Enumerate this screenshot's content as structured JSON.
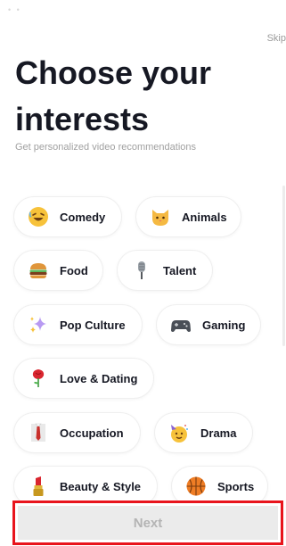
{
  "header": {
    "status_dots": "• •",
    "skip_label": "Skip",
    "title": "Choose your interests",
    "subtitle": "Get personalized video recommendations"
  },
  "interests": [
    {
      "label": "Comedy",
      "icon": "laughing-face-icon"
    },
    {
      "label": "Animals",
      "icon": "cat-face-icon"
    },
    {
      "label": "Food",
      "icon": "burger-icon"
    },
    {
      "label": "Talent",
      "icon": "microphone-icon"
    },
    {
      "label": "Pop Culture",
      "icon": "sparkles-icon"
    },
    {
      "label": "Gaming",
      "icon": "game-controller-icon"
    },
    {
      "label": "Love & Dating",
      "icon": "rose-icon"
    },
    {
      "label": "Occupation",
      "icon": "necktie-icon"
    },
    {
      "label": "Drama",
      "icon": "party-face-icon"
    },
    {
      "label": "Beauty & Style",
      "icon": "lipstick-icon"
    },
    {
      "label": "Sports",
      "icon": "basketball-icon"
    }
  ],
  "footer": {
    "next_label": "Next"
  },
  "colors": {
    "text_primary": "#161823",
    "text_secondary": "#a0a0a0",
    "next_disabled_bg": "#ebebeb",
    "next_disabled_text": "#b4b4b4",
    "highlight_border": "#e8141c"
  }
}
